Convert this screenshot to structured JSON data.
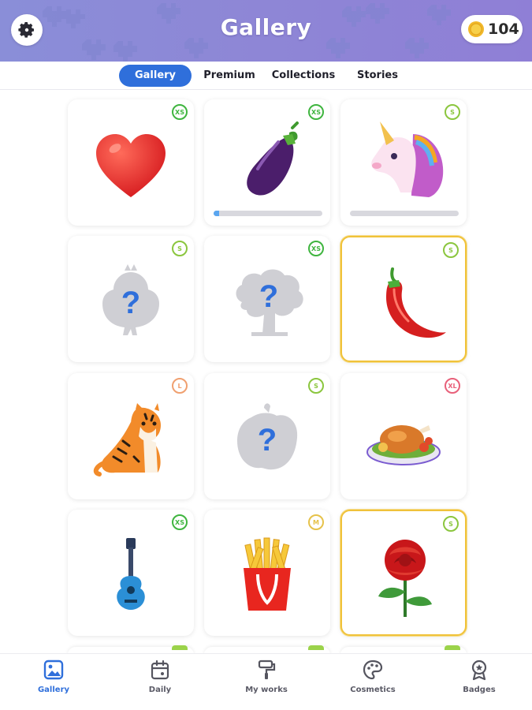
{
  "header": {
    "title": "Gallery",
    "coins": "104",
    "settings_icon": "gear-icon",
    "coin_icon": "coin-icon"
  },
  "tabs": [
    {
      "label": "Gallery",
      "active": true
    },
    {
      "label": "Premium",
      "active": false
    },
    {
      "label": "Collections",
      "active": false
    },
    {
      "label": "Stories",
      "active": false
    }
  ],
  "colors": {
    "accent": "#2f6fdb",
    "header_gradient": [
      "#8a8ed8",
      "#8f7fd6"
    ],
    "badge_xs": "#3fb53f",
    "badge_s": "#8bc63e",
    "badge_m": "#e6c24a",
    "badge_l": "#f0a070",
    "badge_xl": "#e8607a",
    "gold_border": "#f0c23a"
  },
  "gallery": {
    "cards": [
      {
        "name": "heart",
        "icon": "heart-icon",
        "size": "XS",
        "progress": null,
        "gold": false,
        "locked": false
      },
      {
        "name": "eggplant",
        "icon": "eggplant-icon",
        "size": "XS",
        "progress": 0.05,
        "gold": false,
        "locked": false
      },
      {
        "name": "unicorn",
        "icon": "unicorn-icon",
        "size": "S",
        "progress": 0.0,
        "gold": false,
        "locked": false
      },
      {
        "name": "chick-mystery",
        "icon": "mystery-chick-icon",
        "size": "S",
        "progress": null,
        "gold": false,
        "locked": true
      },
      {
        "name": "tree-mystery",
        "icon": "mystery-tree-icon",
        "size": "XS",
        "progress": null,
        "gold": false,
        "locked": true
      },
      {
        "name": "chili-pepper",
        "icon": "chili-pepper-icon",
        "size": "S",
        "progress": null,
        "gold": true,
        "locked": false
      },
      {
        "name": "tiger",
        "icon": "tiger-icon",
        "size": "L",
        "progress": null,
        "gold": false,
        "locked": false
      },
      {
        "name": "pepper-mystery",
        "icon": "mystery-pepper-icon",
        "size": "S",
        "progress": null,
        "gold": false,
        "locked": true
      },
      {
        "name": "roast-chicken",
        "icon": "roast-chicken-icon",
        "size": "XL",
        "progress": null,
        "gold": false,
        "locked": false
      },
      {
        "name": "ukulele",
        "icon": "ukulele-icon",
        "size": "XS",
        "progress": null,
        "gold": false,
        "locked": false
      },
      {
        "name": "french-fries",
        "icon": "french-fries-icon",
        "size": "M",
        "progress": null,
        "gold": false,
        "locked": false
      },
      {
        "name": "rose",
        "icon": "rose-icon",
        "size": "S",
        "progress": null,
        "gold": true,
        "locked": false
      }
    ]
  },
  "bottom_nav": [
    {
      "label": "Gallery",
      "icon": "gallery-image-icon",
      "active": true
    },
    {
      "label": "Daily",
      "icon": "calendar-icon",
      "active": false
    },
    {
      "label": "My works",
      "icon": "paint-roller-icon",
      "active": false
    },
    {
      "label": "Cosmetics",
      "icon": "palette-icon",
      "active": false
    },
    {
      "label": "Badges",
      "icon": "badge-medal-icon",
      "active": false
    }
  ]
}
